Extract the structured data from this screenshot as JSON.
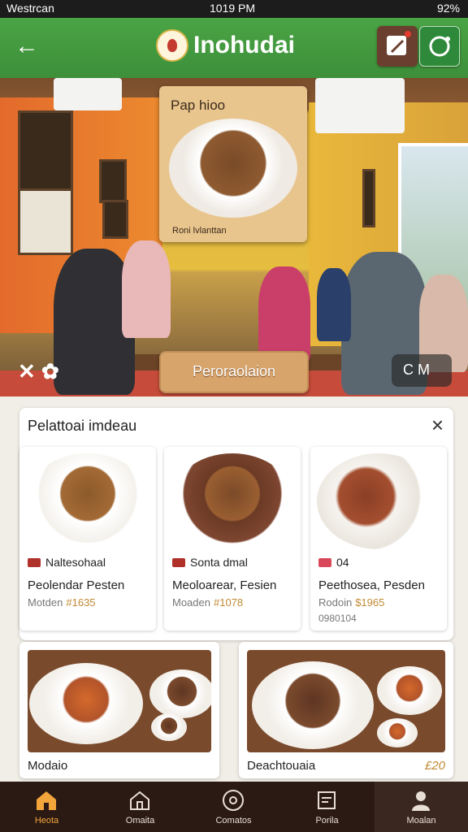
{
  "status_bar": {
    "carrier": "Westrcan",
    "time": "1019 PM",
    "battery": "92%"
  },
  "header": {
    "title": "Inohudai"
  },
  "hero": {
    "menu_card_title": "Pap hioo",
    "menu_card_caption": "Roni lvlanttan",
    "promo_button": "Peroraolaion",
    "chip_text": "C M"
  },
  "panel": {
    "title": "Pelattoai imdeau",
    "close": "×",
    "cards": [
      {
        "tag": "Naltesohaal",
        "title": "Peolendar Pesten",
        "sub": "Motden",
        "price": "#1635",
        "extra": ""
      },
      {
        "tag": "Sonta dmal",
        "title": "Meoloarear, Fesien",
        "sub": "Moaden",
        "price": "#1078",
        "extra": ""
      },
      {
        "tag": "04",
        "title": "Peethosea, Pesden",
        "sub": "Rodoin",
        "price": "$1965",
        "extra": "0980104"
      }
    ]
  },
  "bottom_cards": [
    {
      "label": "Modaio",
      "price": ""
    },
    {
      "label": "Deachtouaia",
      "price": "£20"
    }
  ],
  "nav": [
    {
      "label": "Heota"
    },
    {
      "label": "Omaita"
    },
    {
      "label": "Comatos"
    },
    {
      "label": "Porila"
    },
    {
      "label": "Moalan"
    }
  ]
}
